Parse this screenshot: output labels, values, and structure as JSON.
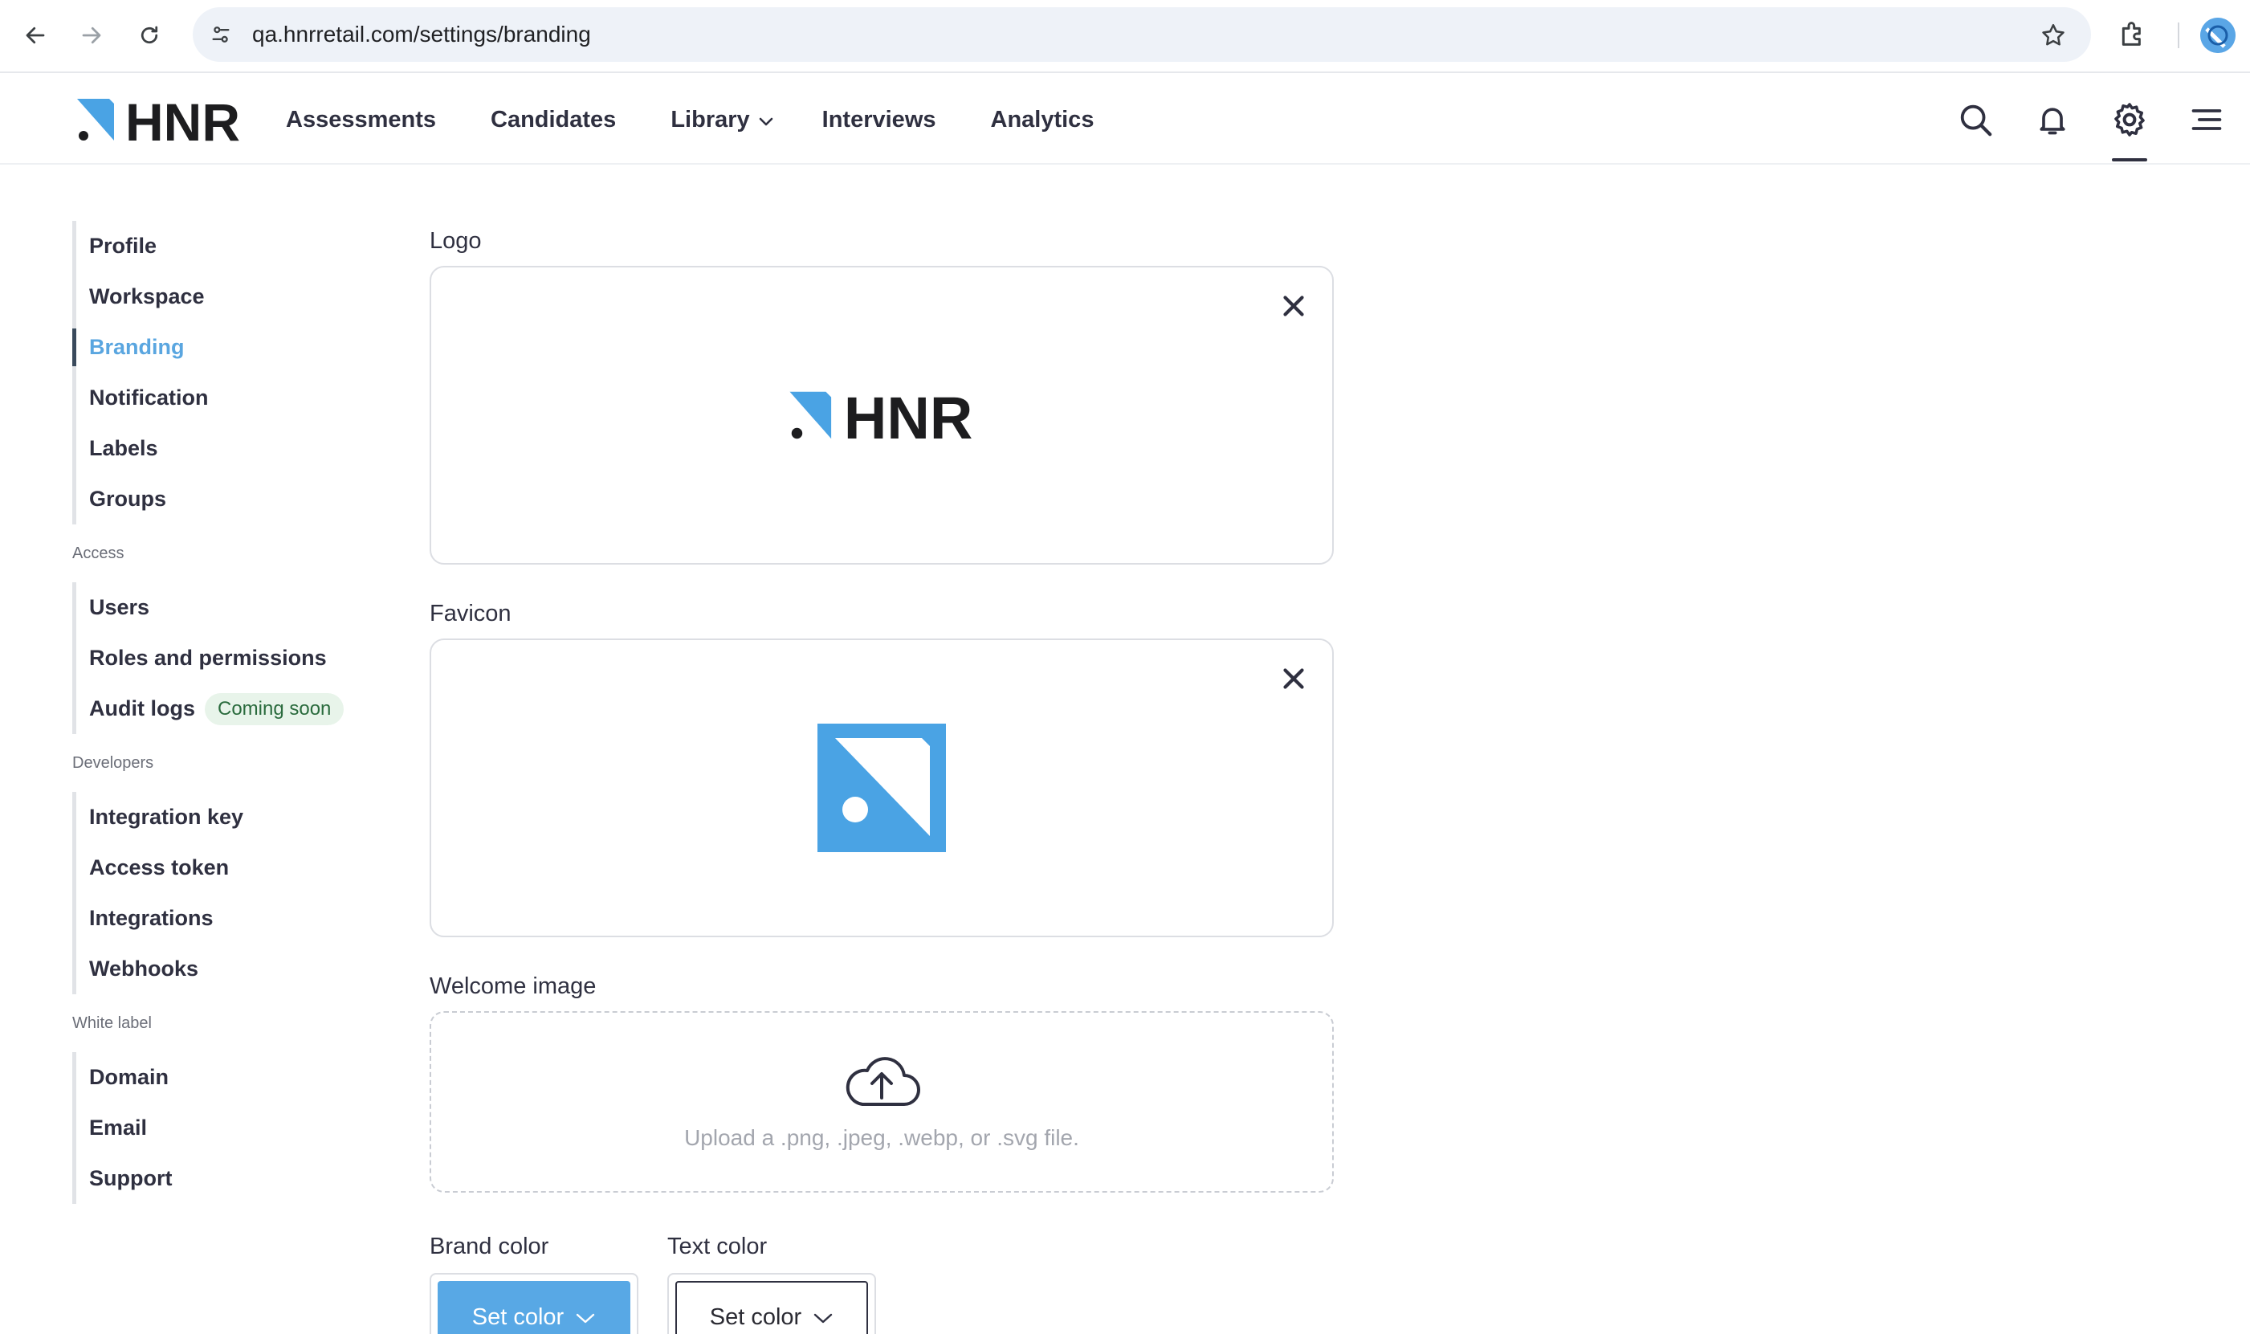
{
  "browser": {
    "url": "qa.hnrretail.com/settings/branding"
  },
  "header": {
    "logo_text": "HNR",
    "nav": [
      "Assessments",
      "Candidates",
      "Library",
      "Interviews",
      "Analytics"
    ]
  },
  "sidebar": {
    "group1": [
      "Profile",
      "Workspace",
      "Branding",
      "Notification",
      "Labels",
      "Groups"
    ],
    "access_title": "Access",
    "access": [
      "Users",
      "Roles and permissions",
      "Audit logs"
    ],
    "audit_badge": "Coming soon",
    "developers_title": "Developers",
    "developers": [
      "Integration key",
      "Access token",
      "Integrations",
      "Webhooks"
    ],
    "white_label_title": "White label",
    "white_label": [
      "Domain",
      "Email",
      "Support"
    ]
  },
  "main": {
    "logo_label": "Logo",
    "logo_preview_text": "HNR",
    "favicon_label": "Favicon",
    "welcome_label": "Welcome image",
    "upload_hint": "Upload a .png, .jpeg, .webp, or .svg file.",
    "brand_color_label": "Brand color",
    "text_color_label": "Text color",
    "set_color_label": "Set color"
  },
  "colors": {
    "accent": "#5aa6e0",
    "brand_blue": "#4aa3e4",
    "badge_bg": "#e8f4ea",
    "badge_text": "#2a6b3d"
  }
}
